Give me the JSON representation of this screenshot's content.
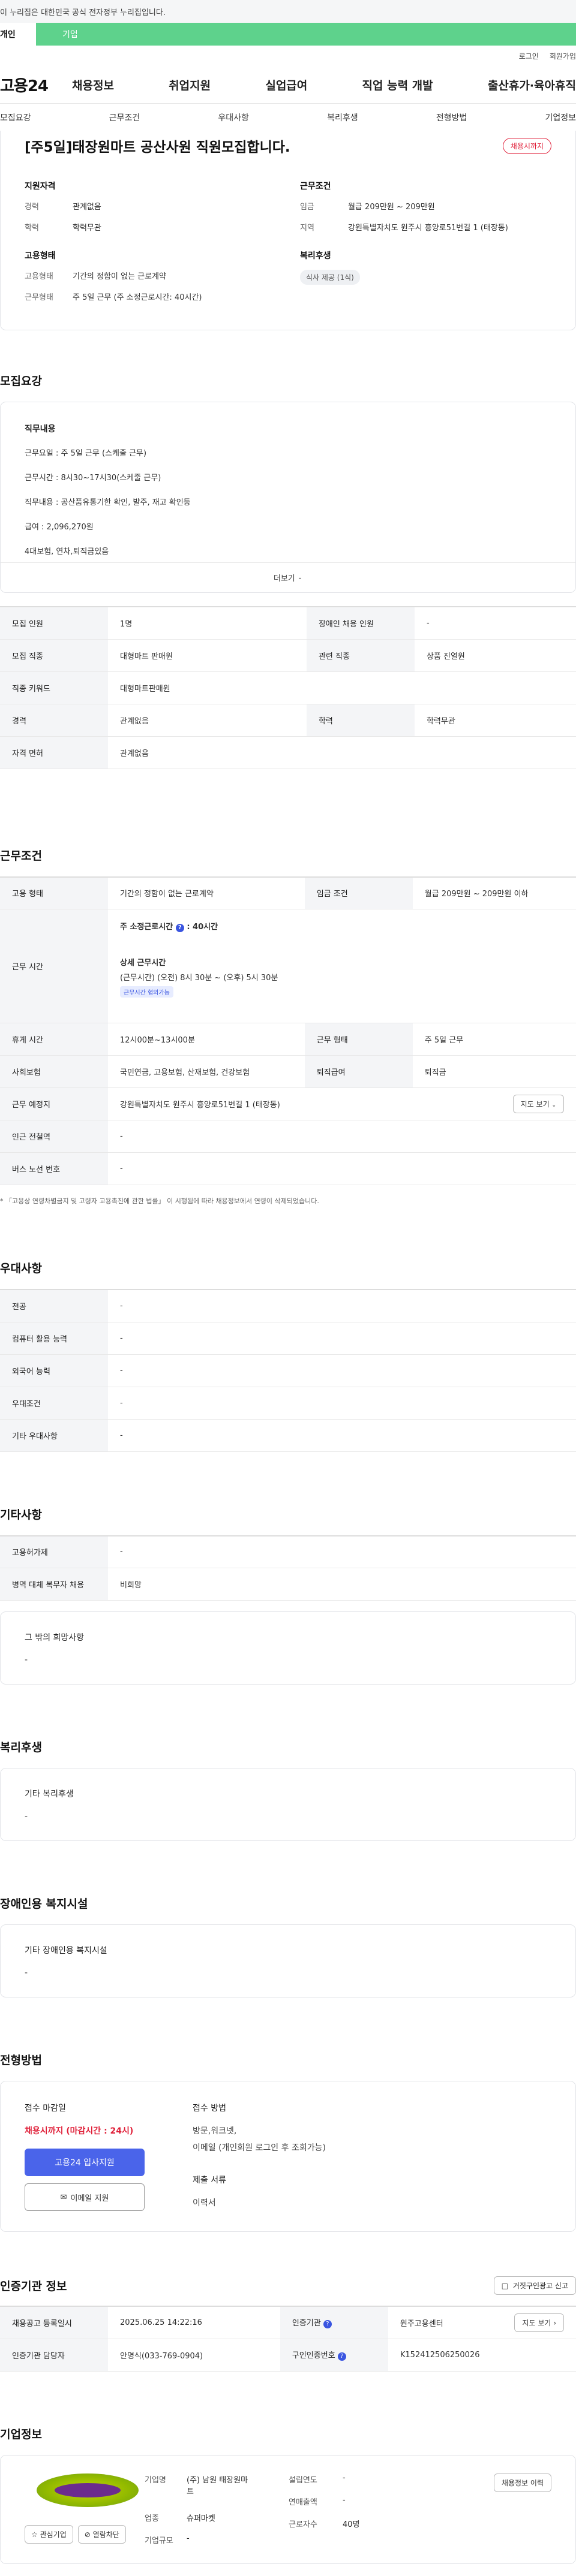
{
  "notice": {
    "text": "이 누리집은 대한민국 공식 전자정부 누리집입니다."
  },
  "gnb": {
    "personal": "개인",
    "company": "기업"
  },
  "util": {
    "login": "로그인",
    "join": "회원가입"
  },
  "header": {
    "logo": "고용24",
    "nav": [
      "채용정보",
      "취업지원",
      "실업급여",
      "직업 능력 개발",
      "출산휴가·육아휴직"
    ]
  },
  "subnav": [
    "모집요강",
    "근무조건",
    "우대사항",
    "복리후생",
    "전형방법",
    "기업정보"
  ],
  "hero": {
    "title": "[주5일]태장원마트 공산사원 직원모집합니다.",
    "badge": "채용시까지",
    "qual_title": "지원자격",
    "qual": [
      {
        "k": "경력",
        "v": "관계없음"
      },
      {
        "k": "학력",
        "v": "학력무관"
      }
    ],
    "cond_title": "근무조건",
    "cond": [
      {
        "k": "임금",
        "v": "월급 209만원 ~ 209만원"
      },
      {
        "k": "지역",
        "v": "강원특별자치도 원주시 흥양로51번길 1 (태장동)"
      }
    ],
    "emp_title": "고용형태",
    "emp": [
      {
        "k": "고용형태",
        "v": "기간의 정함이 없는 근로계약"
      },
      {
        "k": "근무형태",
        "v": "주 5일 근무 (주 소정근로시간: 40시간)"
      }
    ],
    "welfare_title": "복리후생",
    "welfare_tag": "식사 제공 (1식)"
  },
  "recruit": {
    "title": "모집요강",
    "desc_title": "직무내용",
    "desc_lines": [
      "근무요일 :  주  5일 근무 (스케줄 근무)",
      "근무시간 : 8시30~17시30(스케줄 근무)",
      "직무내용 :  공산품유통기한 확인, 발주,  재고 확인등",
      "급여 : 2,096,270원",
      "4대보험, 연차,퇴직금있음"
    ],
    "more": "더보기",
    "table": [
      [
        "모집 인원",
        "1명",
        "장애인 채용 인원",
        "-"
      ],
      [
        "모집 직종",
        "대형마트 판매원",
        "관련 직종",
        "상품 진열원"
      ],
      [
        "직종 키워드",
        "대형마트판매원",
        "",
        ""
      ],
      [
        "경력",
        "관계없음",
        "학력",
        "학력무관"
      ],
      [
        "자격 면허",
        "관계없음",
        "",
        ""
      ]
    ]
  },
  "work": {
    "title": "근무조건",
    "emp_type_k": "고용 형태",
    "emp_type_v": "기간의 정함이 없는 근로계약",
    "wage_k": "임금 조건",
    "wage_v": "월급 209만원 ~ 209만원 이하",
    "hours_k": "근무 시간",
    "weekly_label": "주 소정근로시간",
    "weekly_value": ": 40시간",
    "detail_title": "상세 근무시간",
    "detail_value": "(근무시간) (오전) 8시 30분 ~ (오후) 5시 30분",
    "detail_tag": "근무시간 협의가능",
    "rest_k": "휴게 시간",
    "rest_v": "12시00분~13시00분",
    "form_k": "근무 형태",
    "form_v": "주 5일 근무",
    "ins_k": "사회보험",
    "ins_v": "국민연금, 고용보험, 산재보험, 건강보험",
    "sev_k": "퇴직급여",
    "sev_v": "퇴직금",
    "place_k": "근무 예정지",
    "place_v": "강원특별자치도 원주시 흥양로51번길 1 (태장동)",
    "map_btn": "지도 보기",
    "subway_k": "인근 전철역",
    "subway_v": "-",
    "bus_k": "버스 노선 번호",
    "bus_v": "-",
    "note": "* 「고용상 연령차별금지 및 고령자 고용촉진에 관한 법률」 이 시행됨에 따라 채용정보에서 연령이 삭제되었습니다."
  },
  "pref": {
    "title": "우대사항",
    "rows": [
      [
        "전공",
        "-"
      ],
      [
        "컴퓨터 활용 능력",
        "-"
      ],
      [
        "외국어 능력",
        "-"
      ],
      [
        "우대조건",
        "-"
      ],
      [
        "기타 우대사항",
        "-"
      ]
    ]
  },
  "etc": {
    "title": "기타사항",
    "rows": [
      [
        "고용허가제",
        "-"
      ],
      [
        "병역 대체 복무자 채용",
        "비희망"
      ]
    ],
    "other_title": "그 밖의 희망사항",
    "other_value": "-"
  },
  "welfare": {
    "title": "복리후생",
    "sub": "기타 복리후생",
    "value": "-"
  },
  "disabled": {
    "title": "장애인용 복지시설",
    "sub": "기타 장애인용 복지시설",
    "value": "-"
  },
  "process": {
    "title": "전형방법",
    "deadline_title": "접수 마감일",
    "deadline_value": "채용시까지 (마감시간 : 24시)",
    "apply_btn": "고용24 입사지원",
    "mail_btn": "이메일 지원",
    "method_title": "접수 방법",
    "method_lines": [
      "방문,워크넷,",
      "이메일 (개인회원 로그인 후 조회가능)"
    ],
    "docs_title": "제출 서류",
    "docs_value": "이력서"
  },
  "cert": {
    "title": "인증기관 정보",
    "report_btn": "거짓구인광고 신고",
    "rows": [
      [
        "채용공고 등록일시",
        "2025.06.25 14:22:16",
        "인증기관",
        "원주고용센터"
      ],
      [
        "인증기관 담당자",
        "안명식(033-769-0904)",
        "구인인증번호",
        "K152412506250026"
      ]
    ],
    "map_btn": "지도 보기"
  },
  "company": {
    "title": "기업정보",
    "fav_btn": "관심기업",
    "block_btn": "열람차단",
    "name_k": "기업명",
    "name_v": "(주) 남원 태장원마트",
    "industry_k": "업종",
    "industry_v": "슈퍼마켓",
    "size_k": "기업규모",
    "size_v": "-",
    "est_k": "설립연도",
    "est_v": "-",
    "sales_k": "연매출액",
    "sales_v": "-",
    "emp_k": "근로자수",
    "emp_v": "40명",
    "history_btn": "채용정보 이력"
  },
  "colors": {
    "brand_green": "#5ed28c",
    "primary_blue": "#4a64ea",
    "alert_red": "#e0213a"
  }
}
